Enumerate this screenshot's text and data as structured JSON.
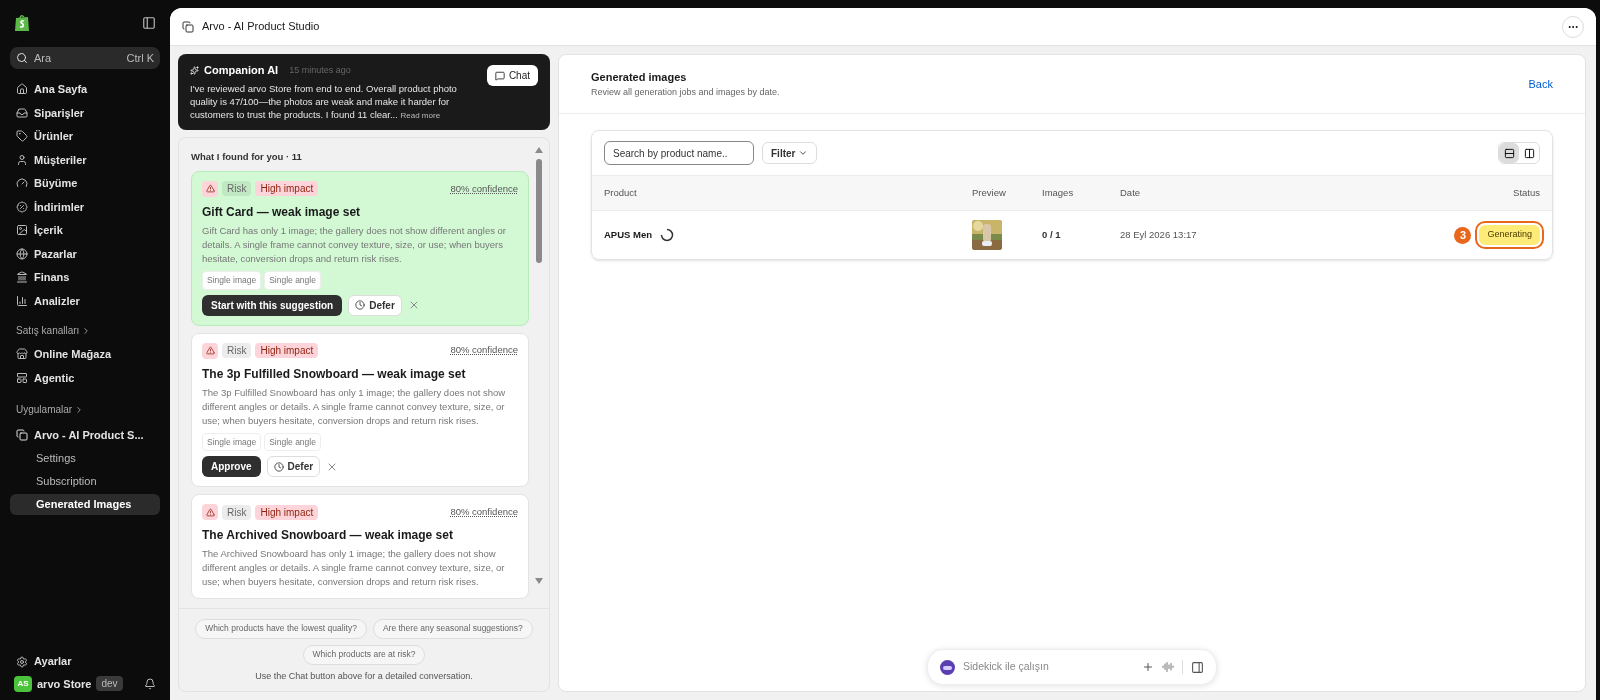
{
  "sidebar": {
    "search": {
      "placeholder": "Ara",
      "shortcut": "Ctrl K"
    },
    "items": [
      {
        "label": "Ana Sayfa",
        "selected": false
      },
      {
        "label": "Siparişler",
        "selected": false
      },
      {
        "label": "Ürünler",
        "selected": false
      },
      {
        "label": "Müşteriler",
        "selected": false
      },
      {
        "label": "Büyüme",
        "selected": false
      },
      {
        "label": "İndirimler",
        "selected": false
      },
      {
        "label": "İçerik",
        "selected": false
      },
      {
        "label": "Pazarlar",
        "selected": false
      },
      {
        "label": "Finans",
        "selected": false
      },
      {
        "label": "Analizler",
        "selected": false
      }
    ],
    "channels_heading": "Satış kanalları",
    "channels": [
      {
        "label": "Online Mağaza"
      },
      {
        "label": "Agentic"
      }
    ],
    "apps_heading": "Uygulamalar",
    "app": {
      "label": "Arvo - AI Product S...",
      "children": [
        {
          "label": "Settings",
          "selected": false
        },
        {
          "label": "Subscription",
          "selected": false
        },
        {
          "label": "Generated Images",
          "selected": true
        }
      ]
    },
    "settings": "Ayarlar",
    "store": {
      "initials": "AS",
      "name": "arvo Store",
      "badge": "dev"
    }
  },
  "app_title": "Arvo - AI Product Studio",
  "companion": {
    "title": "Companion AI",
    "time": "15 minutes ago",
    "text": "I've reviewed arvo Store from end to end. Overall product photo quality is 47/100—the photos are weak and make it harder for customers to trust the products. I found 11 clear...",
    "read_more": "Read more",
    "chat_button": "Chat"
  },
  "findings": {
    "heading": "What I found for you · 11",
    "cards": [
      {
        "selected": true,
        "tag": "Risk",
        "impact": "High impact",
        "confidence": "80% confidence",
        "title": "Gift Card — weak image set",
        "text": "Gift Card has only 1 image; the gallery does not show different angles or details. A single frame cannot convey texture, size, or use; when buyers hesitate, conversion drops and return risk rises.",
        "chips": [
          "Single image",
          "Single angle"
        ],
        "primary": "Start with this suggestion",
        "defer": "Defer"
      },
      {
        "selected": false,
        "tag": "Risk",
        "impact": "High impact",
        "confidence": "80% confidence",
        "title": "The 3p Fulfilled Snowboard — weak image set",
        "text": "The 3p Fulfilled Snowboard has only 1 image; the gallery does not show different angles or details. A single frame cannot convey texture, size, or use; when buyers hesitate, conversion drops and return risk rises.",
        "chips": [
          "Single image",
          "Single angle"
        ],
        "primary": "Approve",
        "defer": "Defer"
      },
      {
        "selected": false,
        "tag": "Risk",
        "impact": "High impact",
        "confidence": "80% confidence",
        "title": "The Archived Snowboard — weak image set",
        "text": "The Archived Snowboard has only 1 image; the gallery does not show different angles or details. A single frame cannot convey texture, size, or use; when buyers hesitate, conversion drops and return risk rises."
      }
    ],
    "suggestions": [
      "Which products have the lowest quality?",
      "Are there any seasonal suggestions?",
      "Which products are at risk?"
    ],
    "footer": "Use the Chat button above for a detailed conversation."
  },
  "generated": {
    "title": "Generated images",
    "subtitle": "Review all generation jobs and images by date.",
    "back": "Back",
    "search": {
      "placeholder": "Search by product name.."
    },
    "filter": "Filter",
    "views": [
      {
        "selected": true
      },
      {
        "selected": false
      }
    ],
    "columns": [
      "Product",
      "Preview",
      "Images",
      "Date",
      "Status"
    ],
    "rows": [
      {
        "product": "APUS Men",
        "loading": true,
        "images": "0 / 1",
        "date": "28 Eyl 2026 13:17",
        "status": "Generating",
        "annotation": "3"
      }
    ]
  },
  "sidekick": {
    "placeholder": "Sidekick ile çalışın"
  }
}
